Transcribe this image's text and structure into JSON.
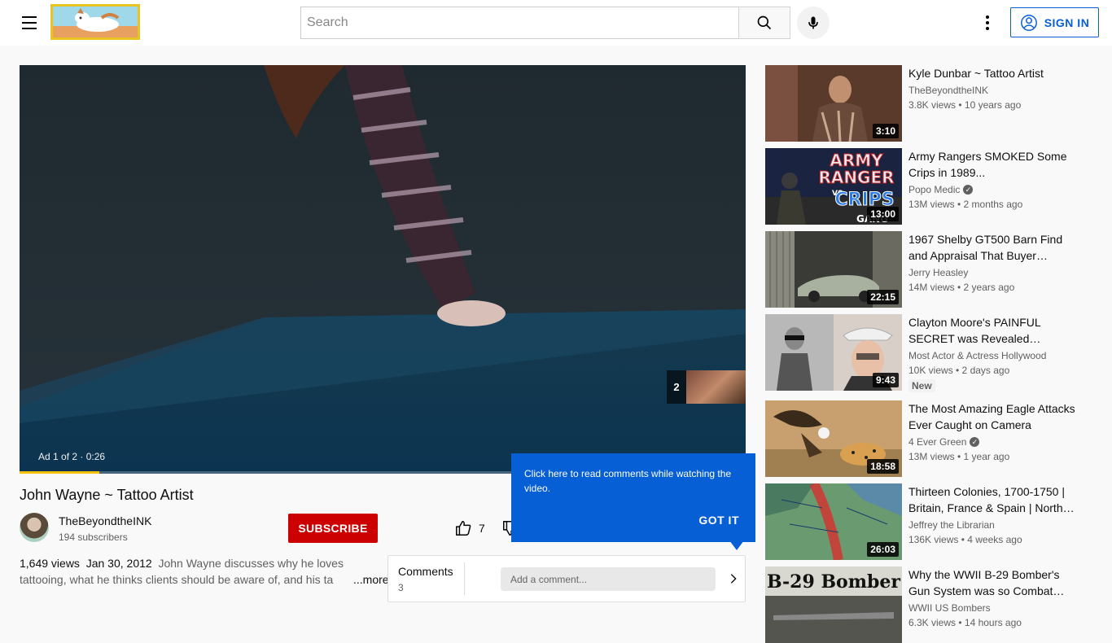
{
  "header": {
    "search_placeholder": "Search",
    "sign_in_label": "SIGN IN"
  },
  "player": {
    "ad_label": "Ad 1 of 2 · 0:26",
    "ad_queue_number": "2",
    "progress_fraction": 0.11
  },
  "video": {
    "title": "John Wayne ~ Tattoo Artist",
    "channel_name": "TheBeyondtheINK",
    "subscribers": "194 subscribers",
    "subscribe_label": "SUBSCRIBE",
    "likes": "7",
    "views": "1,649 views",
    "date": "Jan 30, 2012",
    "description": "John Wayne discusses why he loves tattooing, what he thinks clients should be aware of, and his ta",
    "more_label": "...more"
  },
  "comments": {
    "label": "Comments",
    "count": "3",
    "add_placeholder": "Add a comment..."
  },
  "tooltip": {
    "message": "Click here to read comments while watching the video.",
    "button": "GOT IT"
  },
  "recommendations": [
    {
      "title": "Kyle Dunbar ~ Tattoo Artist",
      "channel": "TheBeyondtheINK",
      "verified": false,
      "meta": "3.8K views • 10 years ago",
      "duration": "3:10",
      "badge": ""
    },
    {
      "title": "Army Rangers SMOKED Some Crips in 1989...",
      "channel": "Popo Medic",
      "verified": true,
      "meta": "13M views • 2 months ago",
      "duration": "13:00",
      "badge": "",
      "thumb_text": [
        "ARMY",
        "RANGER",
        "VS",
        "CRIPS",
        "GANG"
      ]
    },
    {
      "title": "1967 Shelby GT500 Barn Find and Appraisal That Buyer Uses…",
      "channel": "Jerry Heasley",
      "verified": false,
      "meta": "14M views • 2 years ago",
      "duration": "22:15",
      "badge": ""
    },
    {
      "title": "Clayton Moore's PAINFUL SECRET was Revealed Before…",
      "channel": "Most Actor & Actress Hollywood",
      "verified": false,
      "meta": "10K views • 2 days ago",
      "duration": "9:43",
      "badge": "New"
    },
    {
      "title": "The Most Amazing Eagle Attacks Ever Caught on Camera",
      "channel": "4 Ever Green",
      "verified": true,
      "meta": "13M views • 1 year ago",
      "duration": "18:58",
      "badge": ""
    },
    {
      "title": "Thirteen Colonies, 1700-1750 | Britain, France & Spain | North…",
      "channel": "Jeffrey the Librarian",
      "verified": false,
      "meta": "136K views • 4 weeks ago",
      "duration": "26:03",
      "badge": ""
    },
    {
      "title": "Why the WWII B-29 Bomber's Gun System was so Combat…",
      "channel": "WWII US Bombers",
      "verified": false,
      "meta": "6.3K views • 14 hours ago",
      "duration": "",
      "badge": "",
      "thumb_text": [
        "B-29 Bomber"
      ]
    }
  ]
}
